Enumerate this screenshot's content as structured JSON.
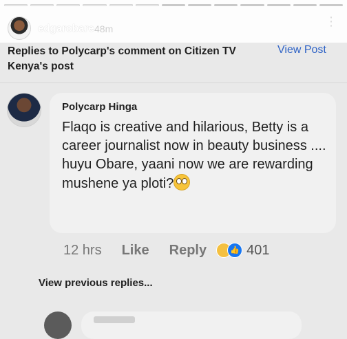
{
  "story": {
    "username": "edgarobare",
    "time_ago": "48m",
    "menu_icon": "kebab-icon",
    "title": "Replies to Polycarp's comment on Citizen TV Kenya's post",
    "view_post": "View Post"
  },
  "comment": {
    "author": "Polycarp Hinga",
    "text": "Flaqo is creative and hilarious, Betty is a career journalist now in beauty business .... huyu Obare, yaani now we are rewarding mushene ya ploti?",
    "time": "12 hrs",
    "like": "Like",
    "reply": "Reply",
    "reaction_count": "401",
    "reaction_icons": [
      "haha-icon",
      "like-icon"
    ]
  },
  "replies": {
    "view_previous": "View previous replies..."
  }
}
